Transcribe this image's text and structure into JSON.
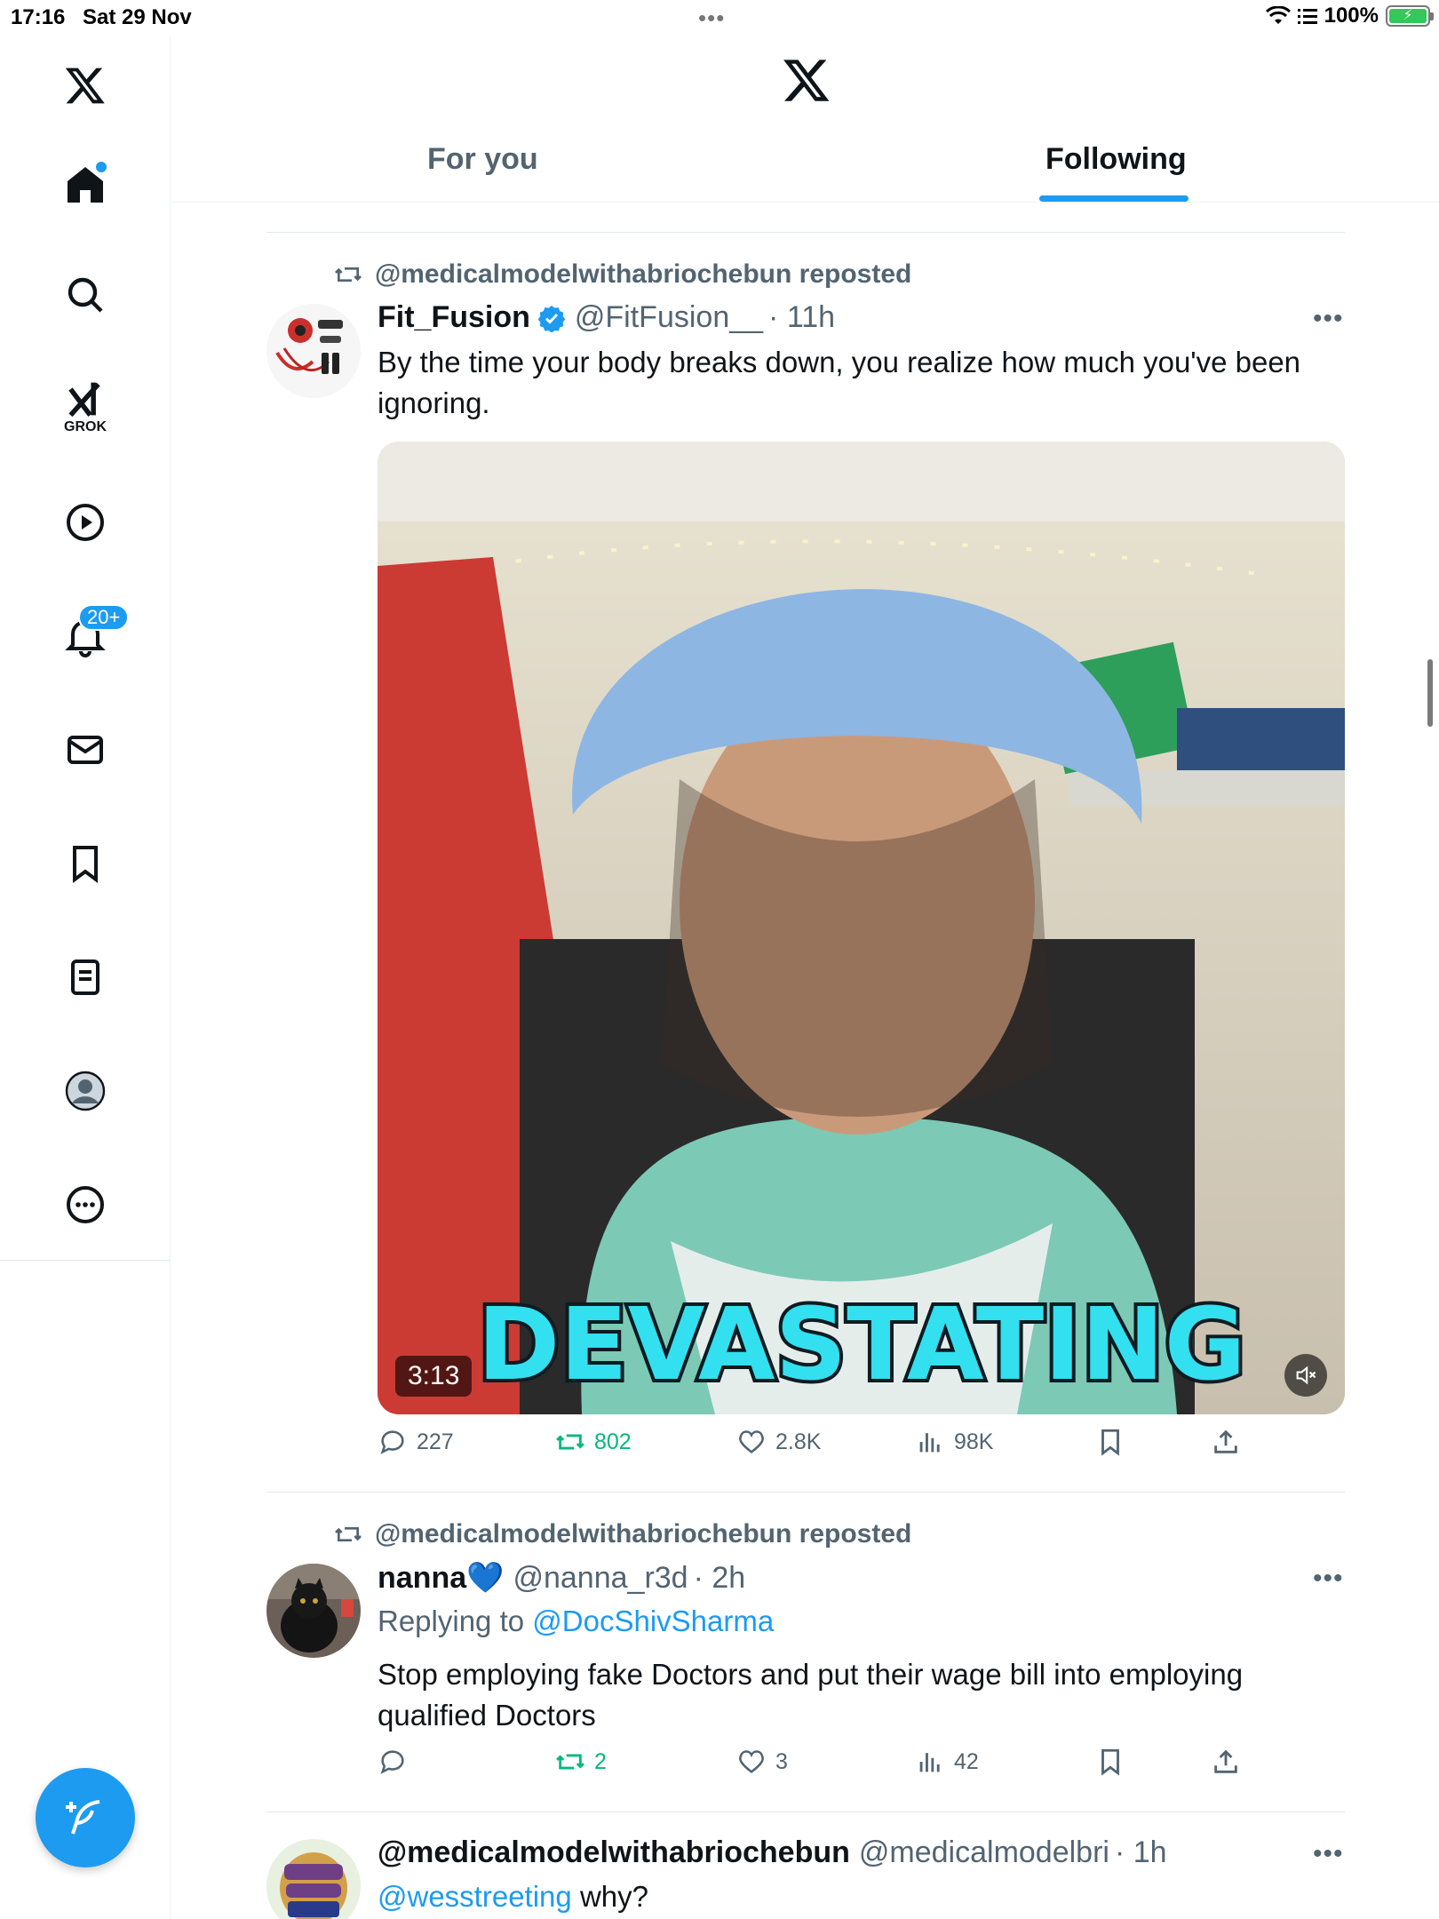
{
  "status_bar": {
    "time": "17:16",
    "date": "Sat 29 Nov",
    "battery": "100%"
  },
  "sidebar": {
    "grok_label": "GROK",
    "notifications_badge": "20+"
  },
  "header": {
    "tabs": [
      {
        "label": "For you",
        "active": false
      },
      {
        "label": "Following",
        "active": true
      }
    ]
  },
  "posts": [
    {
      "repost_by": "@medicalmodelwithabriochebun reposted",
      "name": "Fit_Fusion",
      "verified": true,
      "handle": "@FitFusion__",
      "time": "· 11h",
      "text": "By the time your body breaks down, you realize how much you've been ignoring.",
      "video": {
        "duration": "3:13",
        "caption": "DEVASTATING"
      },
      "stats": {
        "replies": "227",
        "reposts": "802",
        "likes": "2.8K",
        "views": "98K"
      }
    },
    {
      "repost_by": "@medicalmodelwithabriochebun reposted",
      "name": "nanna💙",
      "handle": "@nanna_r3d",
      "time": "· 2h",
      "replying_prefix": "Replying to",
      "replying_to": "@DocShivSharma",
      "text": "Stop employing fake Doctors and put their wage bill into employing qualified Doctors",
      "stats": {
        "replies": "",
        "reposts": "2",
        "likes": "3",
        "views": "42"
      }
    },
    {
      "name": "@medicalmodelwithabriochebun",
      "handle": "@medicalmodelbri",
      "time": "· 1h",
      "mention": "@wesstreeting",
      "text": "why?"
    }
  ],
  "colors": {
    "accent": "#1d9bf0",
    "repost_green": "#00ba7c",
    "muted_text": "#536471"
  }
}
